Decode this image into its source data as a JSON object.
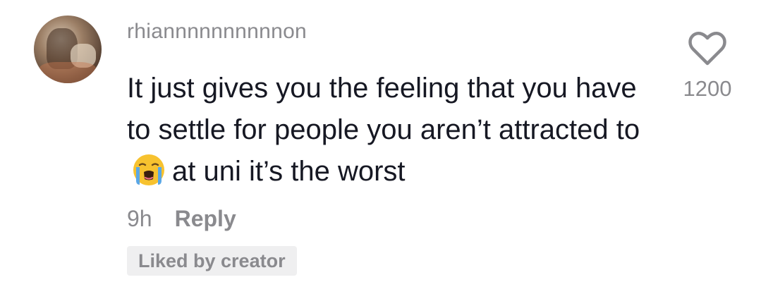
{
  "comment": {
    "username": "rhiannnnnnnnnnon",
    "text_before_emoji": "It just gives you the feeling that you have to settle for people you aren’t attracted to",
    "emoji": "loudly-crying-face",
    "text_after_emoji": "at uni it’s the worst",
    "timestamp": "9h",
    "reply_label": "Reply",
    "badge": "Liked by creator",
    "like_count": "1200"
  },
  "icons": {
    "like": "heart-outline-icon",
    "avatar": "user-avatar"
  },
  "colors": {
    "text_primary": "#161823",
    "text_secondary": "#8a8a8e",
    "badge_bg": "#efeff0",
    "emoji_yellow": "#f7c22f",
    "emoji_tear": "#5aa7e6"
  }
}
